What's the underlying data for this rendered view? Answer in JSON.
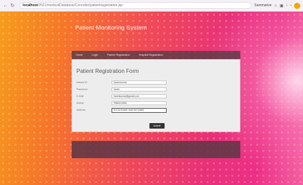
{
  "browser": {
    "url_host": "localhost",
    "url_path": "/2021/medicalDatabase/Conroller/patientregistration.jsp",
    "profile_label": "Summarize",
    "back_icon": "arrow-left-icon",
    "refresh_icon": "refresh-icon"
  },
  "site": {
    "title": "Patient Monitoring System"
  },
  "nav": {
    "items": [
      {
        "label": "Home"
      },
      {
        "label": "Login"
      },
      {
        "label": "Patient Registration"
      },
      {
        "label": "Hospital Registration"
      }
    ]
  },
  "form": {
    "heading": "Patient Registration Form",
    "fields": [
      {
        "label": "Patient ID",
        "value": "harsh.kumar"
      },
      {
        "label": "Password",
        "value": "harsh"
      },
      {
        "label": "E-Mail",
        "value": "harshkumar@gmail.com"
      },
      {
        "label": "Mobile",
        "value": "9966123456"
      },
      {
        "label": "Address",
        "value": "5-9-34 Ameer near the hostel"
      }
    ],
    "submit_label": "submit"
  }
}
